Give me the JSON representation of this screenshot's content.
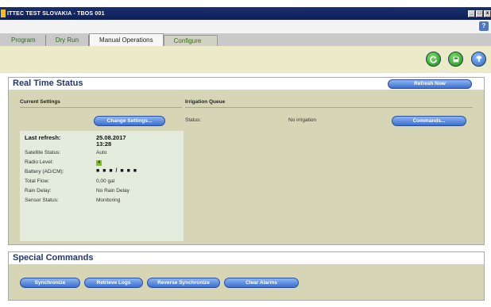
{
  "window": {
    "title": "ITTEC TEST SLOVAKIA - TBOS 001",
    "controls": [
      "_",
      "□",
      "x"
    ]
  },
  "tabs": [
    {
      "label": "Program"
    },
    {
      "label": "Dry Run"
    },
    {
      "label": "Manual Operations",
      "active": true
    },
    {
      "label": "Configure"
    }
  ],
  "toolbar": {
    "icons": [
      "refresh-icon",
      "save-icon",
      "help-icon"
    ]
  },
  "help_icon_glyph": "?",
  "real_time_status": {
    "title": "Real Time Status",
    "refresh_button": "Refresh Now",
    "current_settings": {
      "label": "Current Settings",
      "change_button": "Change Settings...",
      "last_refresh_label": "Last refresh:",
      "last_refresh_date": "25.08.2017",
      "last_refresh_time": "13:28",
      "rows": [
        {
          "label": "Satellite Status:",
          "value": "Auto"
        },
        {
          "label": "Radio Level:",
          "value": "4"
        },
        {
          "label": "Battery (AD/CM):",
          "value": "■ ■ ■ / ■ ■ ■"
        },
        {
          "label": "Total Flow:",
          "value": "0,00 gal"
        },
        {
          "label": "Rain Delay:",
          "value": "No Rain Delay"
        },
        {
          "label": "Sensor Status:",
          "value": "Monitoring"
        }
      ]
    },
    "irrigation_queue": {
      "label": "Irrigation Queue",
      "status_label": "Status:",
      "status_value": "No irrigation",
      "commands_button": "Commands..."
    }
  },
  "special_commands": {
    "title": "Special Commands",
    "buttons": [
      "Synchronize",
      "Retrieve Logs",
      "Reverse Synchronize",
      "Clear Alarms"
    ]
  },
  "colors": {
    "titlebar": "#0d1f55",
    "panel_bg": "#d6d6b6",
    "button_blue": "#3c6fd0",
    "title_blue": "#22386e"
  }
}
